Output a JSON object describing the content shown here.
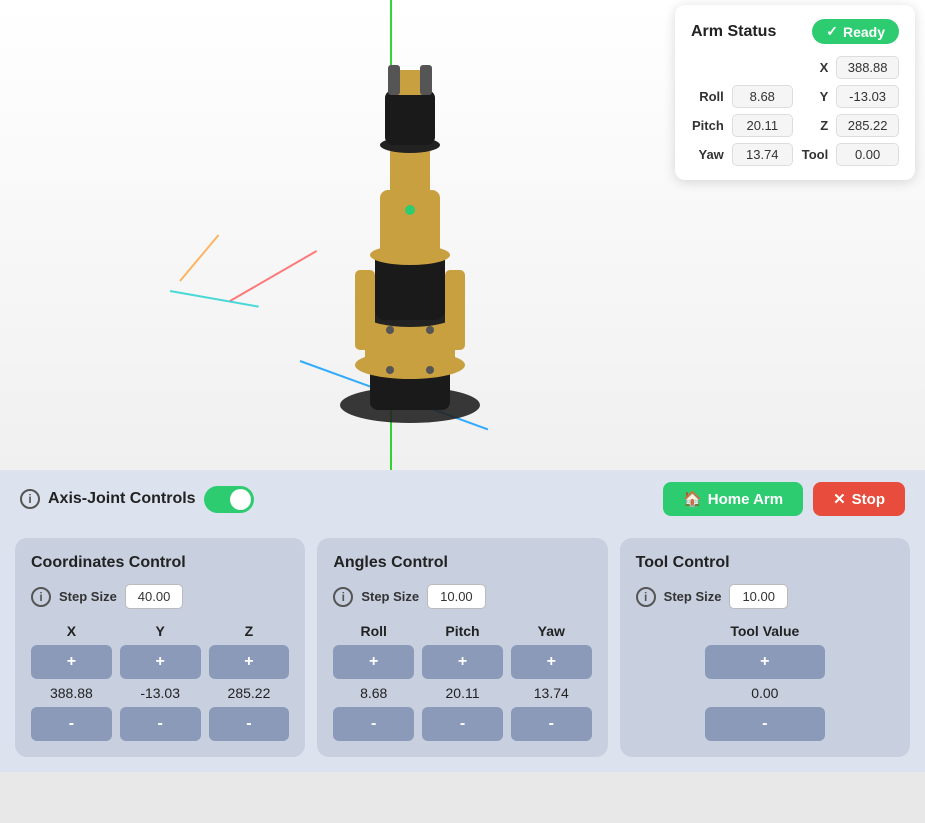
{
  "arm_status": {
    "title": "Arm Status",
    "status": "Ready",
    "x_label": "X",
    "y_label": "Y",
    "z_label": "Z",
    "roll_label": "Roll",
    "pitch_label": "Pitch",
    "yaw_label": "Yaw",
    "tool_label": "Tool",
    "x_value": "388.88",
    "y_value": "-13.03",
    "z_value": "285.22",
    "roll_value": "8.68",
    "pitch_value": "20.11",
    "yaw_value": "13.74",
    "tool_value": "0.00"
  },
  "controls_bar": {
    "label": "Axis-Joint Controls",
    "info_label": "i",
    "home_btn": "Home Arm",
    "stop_btn": "Stop",
    "toggle_state": "on"
  },
  "coordinates_panel": {
    "title": "Coordinates Control",
    "step_label": "Step Size",
    "step_value": "40.00",
    "x_label": "X",
    "y_label": "Y",
    "z_label": "Z",
    "plus": "+",
    "minus": "-",
    "x_value": "388.88",
    "y_value": "-13.03",
    "z_value": "285.22"
  },
  "angles_panel": {
    "title": "Angles Control",
    "step_label": "Step Size",
    "step_value": "10.00",
    "roll_label": "Roll",
    "pitch_label": "Pitch",
    "yaw_label": "Yaw",
    "plus": "+",
    "minus": "-",
    "roll_value": "8.68",
    "pitch_value": "20.11",
    "yaw_value": "13.74"
  },
  "tool_panel": {
    "title": "Tool Control",
    "step_label": "Step Size",
    "step_value": "10.00",
    "tool_label": "Tool Value",
    "plus": "+",
    "minus": "-",
    "tool_value": "0.00"
  }
}
